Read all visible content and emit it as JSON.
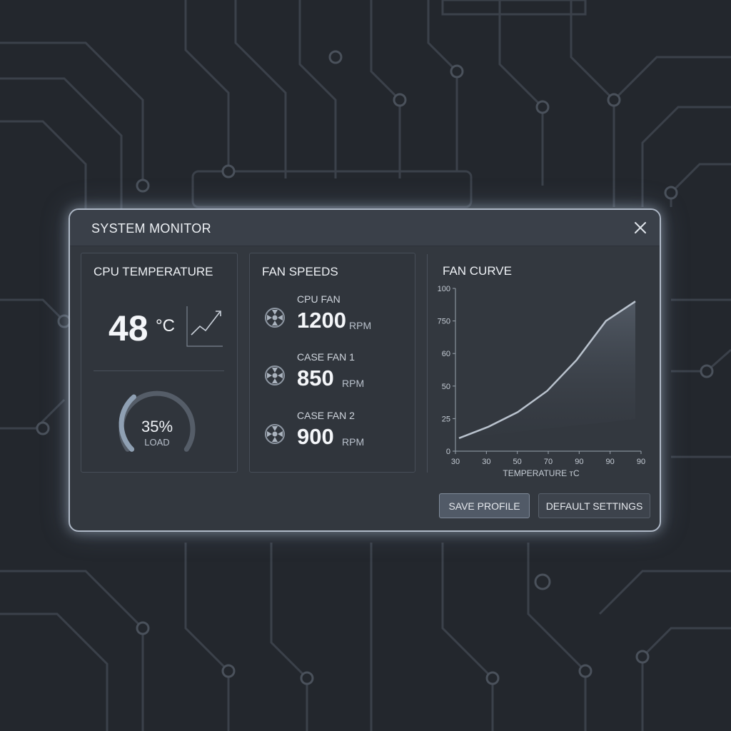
{
  "window": {
    "title": "SYSTEM MONITOR"
  },
  "cpu": {
    "title": "CPU TEMPERATURE",
    "temperature": "48",
    "unit": "°C",
    "load": {
      "value": "35%",
      "label": "LOAD",
      "fraction": 0.35
    }
  },
  "fans": {
    "title": "FAN SPEEDS",
    "items": [
      {
        "name": "CPU FAN",
        "speed": "1200",
        "unit": "RPM"
      },
      {
        "name": "CASE FAN 1",
        "speed": "850",
        "unit": "RPM"
      },
      {
        "name": "CASE FAN 2",
        "speed": "900",
        "unit": "RPM"
      }
    ]
  },
  "fan_curve": {
    "title": "FAN CURVE"
  },
  "chart_data": {
    "type": "area",
    "title": "FAN CURVE",
    "xlabel": "TEMPERATURE тC",
    "ylabel": "",
    "x_tick_labels": [
      "30",
      "30",
      "50",
      "70",
      "90",
      "90",
      "90"
    ],
    "y_tick_labels": [
      "0",
      "25",
      "50",
      "60",
      "750",
      "100"
    ],
    "series": [
      {
        "x": [
          0,
          1,
          2,
          3,
          4,
          5,
          6
        ],
        "y": [
          8,
          15,
          24,
          37,
          56,
          80,
          92
        ]
      }
    ],
    "grid": false,
    "legend": "none"
  },
  "buttons": {
    "save": "SAVE PROFILE",
    "default": "DEFAULT SETTINGS"
  },
  "icons": {
    "close": "close-icon",
    "fan": "fan-icon",
    "trend": "trend-up-icon"
  },
  "colors": {
    "accent": "#aeb8c6",
    "panel": "#30353c",
    "background": "#23272d"
  }
}
